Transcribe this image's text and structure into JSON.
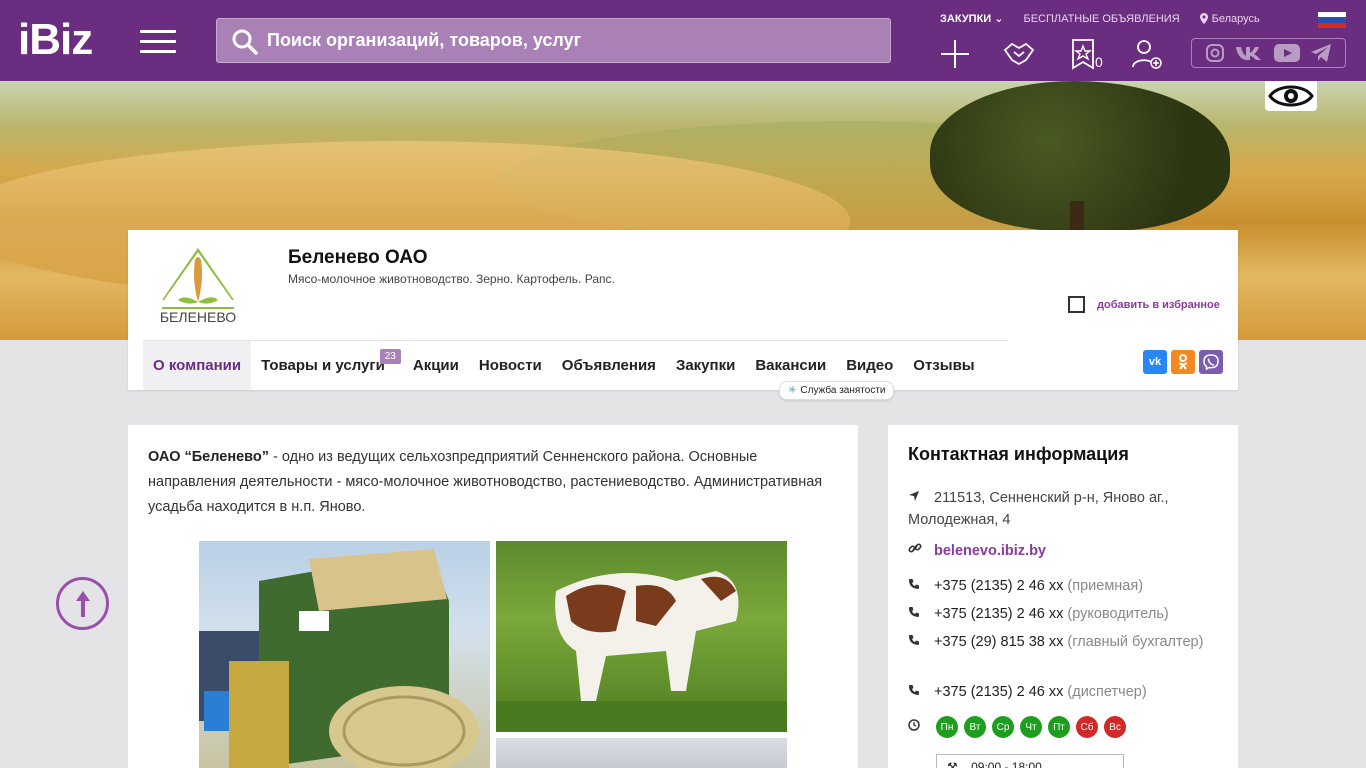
{
  "header": {
    "logo": "iBiz",
    "search_placeholder": "Поиск организаций, товаров, услуг",
    "links": {
      "purchases": "ЗАКУПКИ",
      "free_ads": "БЕСПЛАТНЫЕ ОБЪЯВЛЕНИЯ",
      "region": "Беларусь"
    },
    "favorites_count": "0"
  },
  "company": {
    "title": "Беленево ОАО",
    "subtitle": "Мясо-молочное животноводство. Зерно. Картофель. Рапс.",
    "logo_text": "БЕЛЕНЕВО",
    "add_favorite": "добавить в избранное"
  },
  "nav": {
    "tabs": [
      {
        "label": "О компании",
        "active": true
      },
      {
        "label": "Товары и услуги",
        "badge": "23"
      },
      {
        "label": "Акции"
      },
      {
        "label": "Новости"
      },
      {
        "label": "Объявления"
      },
      {
        "label": "Закупки"
      },
      {
        "label": "Вакансии"
      },
      {
        "label": "Видео"
      },
      {
        "label": "Отзывы"
      }
    ],
    "tooltip": "Служба занятости"
  },
  "share": {
    "vk": "vk",
    "ok": "ok",
    "viber": "viber"
  },
  "about": {
    "name_bold": "ОАО “Беленево”",
    "text": " - одно из ведущих сельхозпредприятий Сенненского района. Основные направления деятельности - мясо-молочное животноводство, растениеводство. Административная усадьба находится в н.п. Яново."
  },
  "contact": {
    "heading": "Контактная информация",
    "address": "211513, Сенненский р-н, Яново аг., Молодежная, 4",
    "site": "belenevo.ibiz.by",
    "phones": [
      {
        "number": "+375 (2135) 2 46 xx",
        "note": "(приемная)"
      },
      {
        "number": "+375 (2135) 2 46 xx",
        "note": "(руководитель)"
      },
      {
        "number": "+375 (29) 815 38 xx",
        "note": "(главный бухгалтер)"
      },
      {
        "number": "+375 (2135) 2 46 xx",
        "note": "(диспетчер)"
      }
    ],
    "days": [
      {
        "label": "Пн",
        "open": true
      },
      {
        "label": "Вт",
        "open": true
      },
      {
        "label": "Ср",
        "open": true
      },
      {
        "label": "Чт",
        "open": true
      },
      {
        "label": "Пт",
        "open": true
      },
      {
        "label": "Сб",
        "open": false
      },
      {
        "label": "Вс",
        "open": false
      }
    ],
    "hours": "09:00 - 18:00"
  },
  "colors": {
    "brand": "#6b2d80",
    "accent": "#8a3b9b",
    "open": "#1e9e1e",
    "closed": "#d22828"
  }
}
